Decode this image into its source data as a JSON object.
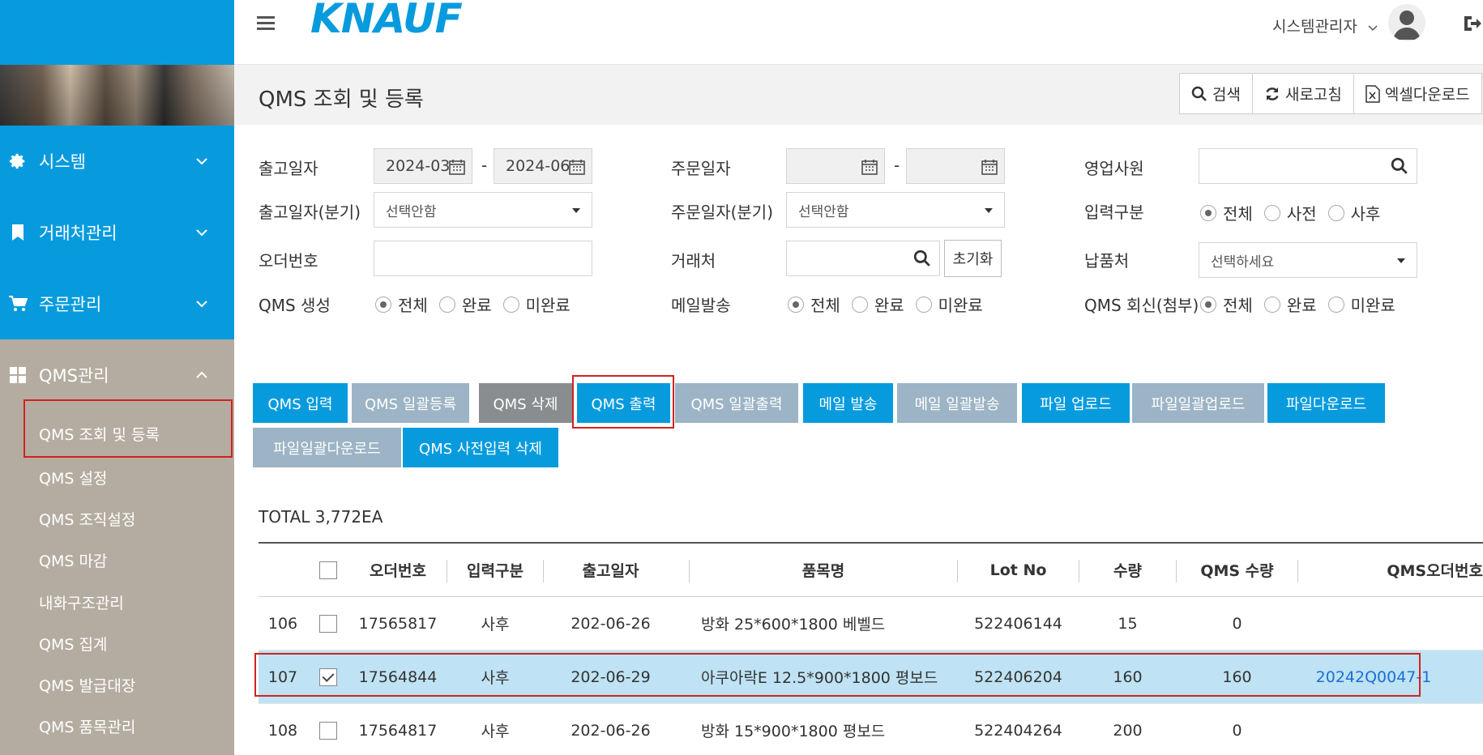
{
  "header": {
    "logo": "KNAUF",
    "user_name": "시스템관리자"
  },
  "sidebar": {
    "menus": [
      {
        "label": "시스템",
        "icon": "gear-icon"
      },
      {
        "label": "거래처관리",
        "icon": "bookmark-icon"
      },
      {
        "label": "주문관리",
        "icon": "cart-icon"
      },
      {
        "label": "QMS관리",
        "icon": "grid-icon"
      }
    ],
    "sub_items": [
      "QMS 조회 및 등록",
      "QMS 설정",
      "QMS 조직설정",
      "QMS 마감",
      "내화구조관리",
      "QMS 집계",
      "QMS 발급대장",
      "QMS 품목관리"
    ]
  },
  "page": {
    "title": "QMS 조회 및 등록",
    "tools": {
      "search": "검색",
      "refresh": "새로고침",
      "excel": "엑셀다운로드"
    }
  },
  "filters": {
    "ship_date_label": "출고일자",
    "ship_date_from": "2024-03",
    "ship_date_to": "2024-06",
    "ship_quarter_label": "출고일자(분기)",
    "ship_quarter_value": "선택안함",
    "order_no_label": "오더번호",
    "qms_create_label": "QMS 생성",
    "order_date_label": "주문일자",
    "order_quarter_label": "주문일자(분기)",
    "order_quarter_value": "선택안함",
    "customer_label": "거래처",
    "reset_label": "초기화",
    "mail_label": "메일발송",
    "sales_label": "영업사원",
    "input_type_label": "입력구분",
    "delivery_label": "납품처",
    "delivery_value": "선택하세요",
    "qms_reply_label": "QMS 회신(첨부)",
    "opt_all": "전체",
    "opt_done": "완료",
    "opt_undone": "미완료",
    "opt_pre": "사전",
    "opt_post": "사후"
  },
  "actions": {
    "qms_input": "QMS 입력",
    "qms_bulk_register": "QMS 일괄등록",
    "qms_delete": "QMS 삭제",
    "qms_print": "QMS 출력",
    "qms_bulk_print": "QMS 일괄출력",
    "mail_send": "메일 발송",
    "mail_bulk_send": "메일 일괄발송",
    "file_upload": "파일 업로드",
    "file_bulk_upload": "파일일괄업로드",
    "file_download": "파일다운로드",
    "file_bulk_download": "파일일괄다운로드",
    "qms_pre_delete": "QMS 사전입력 삭제"
  },
  "total": "TOTAL 3,772EA",
  "table": {
    "headers": {
      "order_no": "오더번호",
      "input_type": "입력구분",
      "ship_date": "출고일자",
      "item": "품목명",
      "lot": "Lot No",
      "qty": "수량",
      "qms_qty": "QMS 수량",
      "qms_order": "QMS오더번호"
    },
    "rows": [
      {
        "no": "106",
        "order_no": "17565817",
        "input_type": "사후",
        "ship_date": "202-06-26",
        "item": "방화 25*600*1800 베벨드",
        "lot": "522406144",
        "qty": "15",
        "qms_qty": "0",
        "qms_order": ""
      },
      {
        "no": "107",
        "order_no": "17564844",
        "input_type": "사후",
        "ship_date": "202-06-29",
        "item": "아쿠아락E 12.5*900*1800 평보드",
        "lot": "522406204",
        "qty": "160",
        "qms_qty": "160",
        "qms_order": "20242Q0047-1"
      },
      {
        "no": "108",
        "order_no": "17564817",
        "input_type": "사후",
        "ship_date": "202-06-26",
        "item": "방화 15*900*1800 평보드",
        "lot": "522404264",
        "qty": "200",
        "qms_qty": "0",
        "qms_order": ""
      }
    ]
  }
}
